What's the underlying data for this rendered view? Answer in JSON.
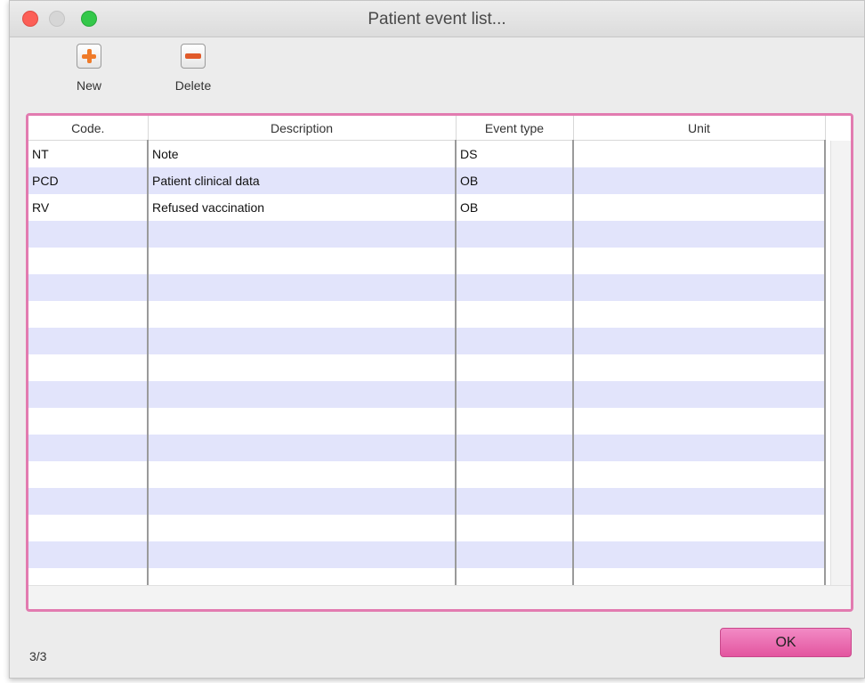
{
  "window": {
    "title": "Patient event list..."
  },
  "toolbar": {
    "new_label": "New",
    "delete_label": "Delete"
  },
  "table": {
    "columns": [
      "Code.",
      "Description",
      "Event type",
      "Unit"
    ],
    "rows": [
      {
        "code": "NT",
        "description": "Note",
        "event_type": "DS",
        "unit": ""
      },
      {
        "code": "PCD",
        "description": "Patient clinical data",
        "event_type": "OB",
        "unit": ""
      },
      {
        "code": "RV",
        "description": "Refused vaccination",
        "event_type": "OB",
        "unit": ""
      }
    ]
  },
  "footer": {
    "record_count": "3/3",
    "ok_label": "OK"
  },
  "colors": {
    "accent_pink": "#e27bb0",
    "row_alt": "#e2e4fb",
    "icon_orange": "#ef7b2a"
  }
}
